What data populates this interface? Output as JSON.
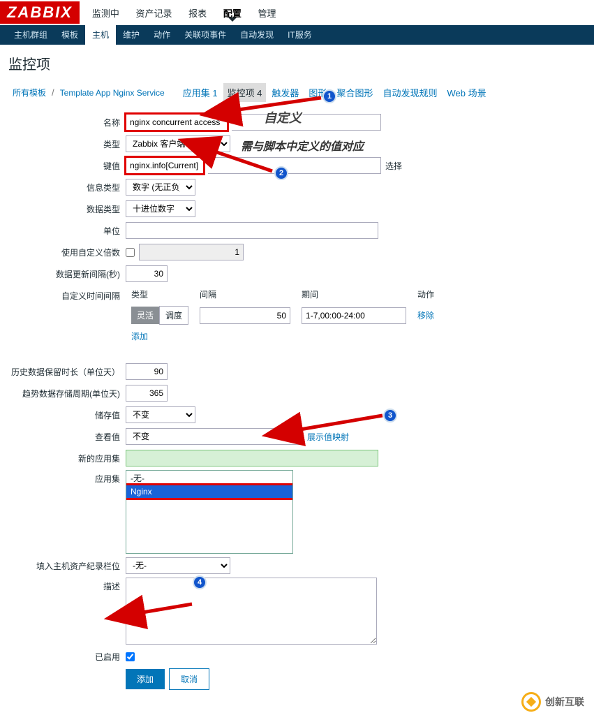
{
  "logo": "ZABBIX",
  "topnav": [
    "监测中",
    "资产记录",
    "报表",
    "配置",
    "管理"
  ],
  "topnav_active": 3,
  "bluenav": [
    "主机群组",
    "模板",
    "主机",
    "维护",
    "动作",
    "关联项事件",
    "自动发现",
    "IT服务"
  ],
  "bluenav_active": 2,
  "page_title": "监控项",
  "breadcrumb": {
    "all": "所有模板",
    "tmpl": "Template App Nginx Service"
  },
  "tabs": [
    {
      "l": "应用集 1"
    },
    {
      "l": "监控项 4",
      "active": true
    },
    {
      "l": "触发器"
    },
    {
      "l": "图形"
    },
    {
      "l": "聚合图形"
    },
    {
      "l": "自动发现规则"
    },
    {
      "l": "Web 场景"
    }
  ],
  "labels": {
    "name": "名称",
    "type": "类型",
    "key": "键值",
    "info_type": "信息类型",
    "data_type": "数据类型",
    "unit": "单位",
    "multiplier": "使用自定义倍数",
    "interval": "数据更新间隔(秒)",
    "flex": "自定义时间间隔",
    "history": "历史数据保留时长（单位天）",
    "trend": "趋势数据存储周期(单位天)",
    "delta": "储存值",
    "valuemap": "查看值",
    "newapp": "新的应用集",
    "app": "应用集",
    "inventory": "填入主机资产纪录栏位",
    "desc": "描述",
    "enabled": "已启用",
    "flex_type": "类型",
    "flex_interval": "间隔",
    "flex_period": "期间",
    "flex_action": "动作"
  },
  "values": {
    "name": "nginx concurrent access",
    "type": "Zabbix 客户端",
    "key": "nginx.info[Current]",
    "key_btn": "选择",
    "info_type": "数字 (无正负)",
    "data_type": "十进位数字",
    "multiplier": "1",
    "interval": "30",
    "flex_toggle_on": "灵活",
    "flex_toggle_off": "调度",
    "flex_interval": "50",
    "flex_period": "1-7,00:00-24:00",
    "flex_remove": "移除",
    "flex_add": "添加",
    "history": "90",
    "trend": "365",
    "delta": "不变",
    "valuemap": "不变",
    "valuemap_link": "展示值映射",
    "app_options": [
      "-无-",
      "Nginx"
    ],
    "app_selected": 1,
    "inventory": "-无-"
  },
  "annot": {
    "t1": "自定义",
    "t2": "需与脚本中定义的值对应"
  },
  "buttons": {
    "add": "添加",
    "cancel": "取消"
  },
  "watermark": "创新互联"
}
